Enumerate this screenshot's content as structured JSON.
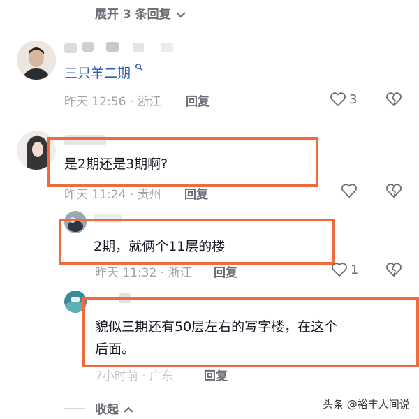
{
  "expand_replies": {
    "label": "展开 3 条回复"
  },
  "comments": [
    {
      "user": "三只羊二期",
      "time": "昨天 12:56 · 浙江",
      "reply": "回复",
      "likes": "3"
    },
    {
      "text": "是2期还是3期啊?",
      "time": "昨天 11:24 · 贵州",
      "reply": "回复"
    },
    {
      "text": "2期，就俩个11层的楼",
      "time": "昨天 11:32 · 浙江",
      "reply": "回复",
      "likes": "1"
    },
    {
      "text_line1": "貌似三期还有50层左右的写字楼，在这个",
      "text_line2": "后面。",
      "time": "7小时前 · 广东",
      "reply": "回复"
    }
  ],
  "collapse": {
    "label": "收起"
  },
  "watermark": "头条 @裕丰人间说",
  "colors": {
    "highlight": "#f06a3e",
    "text": "#161823",
    "meta": "#a1a2a8"
  }
}
